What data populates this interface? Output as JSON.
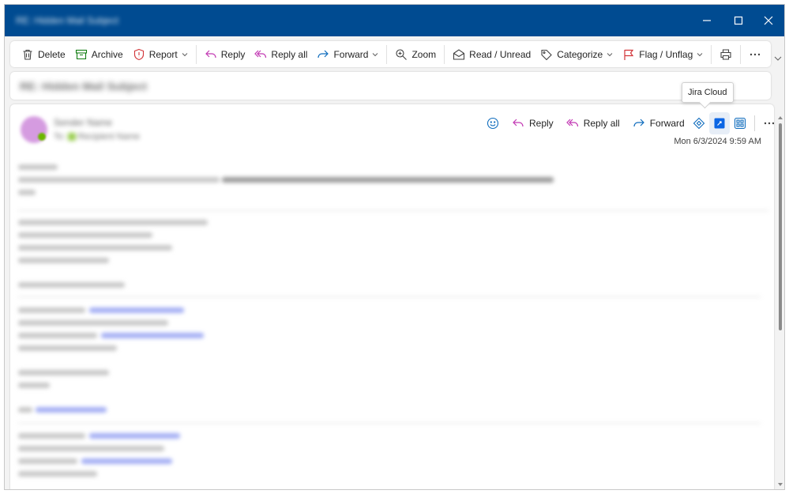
{
  "window": {
    "title": "RE: Hidden Mail Subject"
  },
  "ribbon": {
    "delete": "Delete",
    "archive": "Archive",
    "report": "Report",
    "reply": "Reply",
    "reply_all": "Reply all",
    "forward": "Forward",
    "zoom": "Zoom",
    "read_unread": "Read / Unread",
    "categorize": "Categorize",
    "flag_unflag": "Flag / Unflag"
  },
  "subject": "RE: Hidden Mail Subject",
  "message": {
    "sender_name": "Sender Name",
    "recipients": "Recipient Name",
    "date": "Mon 6/3/2024 9:59 AM",
    "actions": {
      "reply": "Reply",
      "reply_all": "Reply all",
      "forward": "Forward"
    }
  },
  "tooltip": "Jira Cloud",
  "colors": {
    "titlebar": "#004b91",
    "accent": "#0f6cbd",
    "reply_icon": "#c239b3",
    "forward_icon": "#0f6cbd",
    "report_icon": "#d13438",
    "archive_icon": "#107c10",
    "flag_icon": "#d13438"
  }
}
